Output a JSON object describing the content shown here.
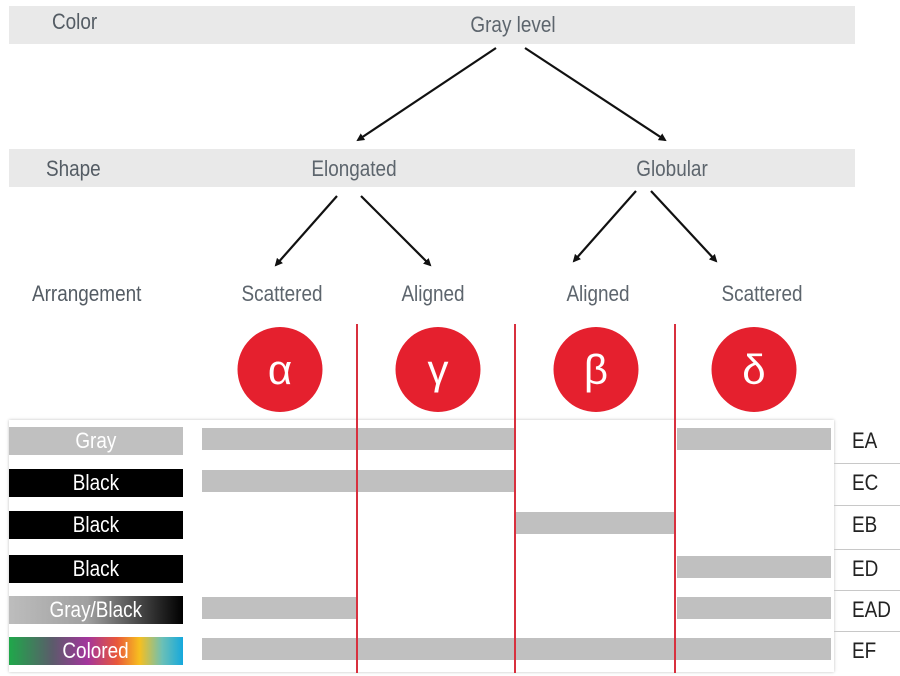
{
  "levels": {
    "color": "Color",
    "shape": "Shape",
    "arrangement": "Arrangement"
  },
  "tree": {
    "root": "Gray level",
    "shapes": [
      "Elongated",
      "Globular"
    ],
    "arrangements": [
      "Scattered",
      "Aligned",
      "Aligned",
      "Scattered"
    ]
  },
  "types": [
    {
      "symbol": "α",
      "name": "alpha"
    },
    {
      "symbol": "γ",
      "name": "gamma"
    },
    {
      "symbol": "β",
      "name": "beta"
    },
    {
      "symbol": "δ",
      "name": "delta"
    }
  ],
  "colors": {
    "accent_red": "#e5202e",
    "divider_red": "#d8303e",
    "band_gray": "#e9e9e9",
    "bar_gray": "#c0c0c0",
    "label_text": "#545c64"
  },
  "rows": [
    {
      "label": "Gray",
      "style": "gray",
      "code": "EA",
      "columns": [
        "alpha",
        "gamma",
        "delta"
      ]
    },
    {
      "label": "Black",
      "style": "black",
      "code": "EC",
      "columns": [
        "alpha",
        "gamma"
      ]
    },
    {
      "label": "Black",
      "style": "black",
      "code": "EB",
      "columns": [
        "beta"
      ]
    },
    {
      "label": "Black",
      "style": "black",
      "code": "ED",
      "columns": [
        "delta"
      ]
    },
    {
      "label": "Gray/Black",
      "style": "grayblack",
      "code": "EAD",
      "columns": [
        "alpha",
        "delta"
      ]
    },
    {
      "label": "Colored",
      "style": "colored",
      "code": "EF",
      "columns": [
        "alpha",
        "gamma",
        "beta",
        "delta"
      ]
    }
  ]
}
